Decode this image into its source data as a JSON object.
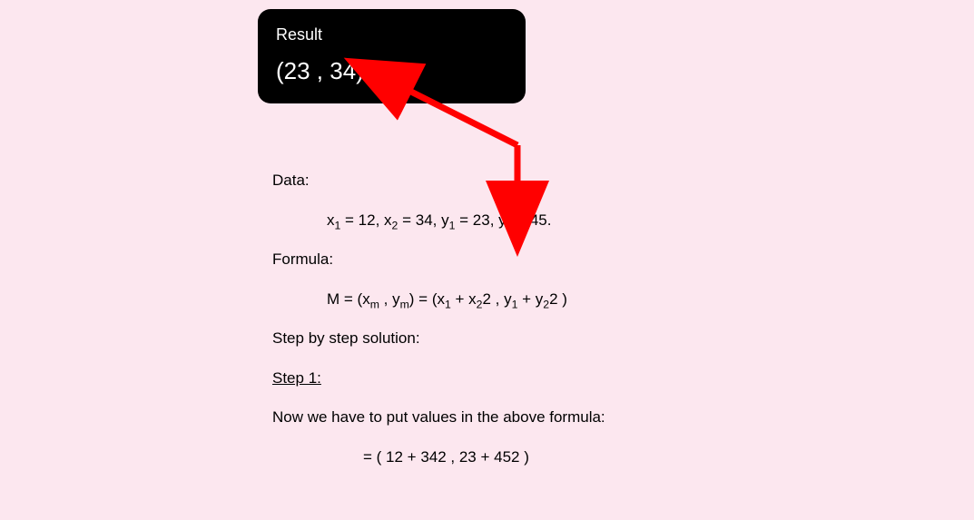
{
  "result": {
    "title": "Result",
    "value": "(23 , 34)"
  },
  "data": {
    "label": "Data:",
    "x1_var": "x",
    "x1_sub": "1",
    "x1_val": " = 12, ",
    "x2_var": "x",
    "x2_sub": "2",
    "x2_val": " = 34, ",
    "y1_var": "y",
    "y1_sub": "1",
    "y1_val": " = 23, ",
    "y2_var": "y",
    "y2_sub": "2",
    "y2_val": " = 45."
  },
  "formula": {
    "label": "Formula:",
    "lhs": "M = (x",
    "m1_sub": "m",
    "mid1": " , y",
    "m2_sub": "m",
    "mid2": ")   =   (x",
    "s1": "1",
    "p1": " + x",
    "s2": "2",
    "p2": "2 , y",
    "s3": "1",
    "p3": " + y",
    "s4": "2",
    "p4": "2 )"
  },
  "solution": {
    "heading": "Step by step solution:",
    "step_label": "Step 1:",
    "step_text": "Now we have to put values in the above formula:",
    "calc": "=   ( 12 + 342 , 23 + 452 )"
  }
}
